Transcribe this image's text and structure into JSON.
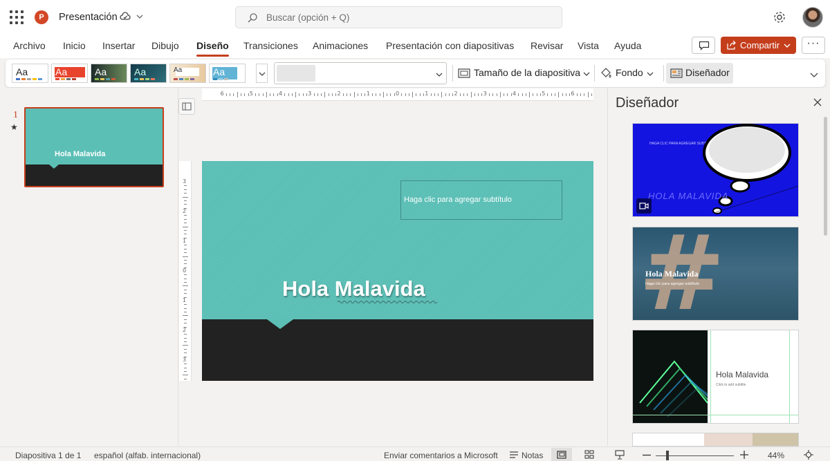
{
  "app": {
    "doc_title": "Presentación",
    "brand_color": "#c43e1c"
  },
  "search": {
    "placeholder": "Buscar (opción + Q)"
  },
  "menu": {
    "tabs": [
      "Archivo",
      "Inicio",
      "Insertar",
      "Dibujo",
      "Diseño",
      "Transiciones",
      "Animaciones",
      "Presentación con diapositivas",
      "Revisar",
      "Vista",
      "Ayuda"
    ],
    "active_tab": "Diseño",
    "share_label": "Compartir",
    "more_label": "···"
  },
  "ribbon": {
    "theme_aa": "Aa",
    "slide_size_label": "Tamaño de la diapositiva",
    "background_label": "Fondo",
    "designer_label": "Diseñador"
  },
  "thumbnails": {
    "slide_number": "1",
    "star": "★",
    "thumb_title": "Hola Malavida"
  },
  "slide": {
    "title": "Hola Malavida",
    "subtitle_placeholder": "Haga clic para agregar subtítulo",
    "accent_color": "#5bbfb6",
    "dark_color": "#222222"
  },
  "rulers": {
    "horizontal_labels": [
      "6",
      "5",
      "4",
      "3",
      "2",
      "1",
      "0",
      "1",
      "2",
      "3",
      "4",
      "5",
      "6"
    ],
    "vertical_labels": [
      "3",
      "2",
      "1",
      "0",
      "1",
      "2",
      "3"
    ]
  },
  "designer": {
    "title": "Diseñador",
    "card1": {
      "small_text": "HAGA CLIC PARA AGREGAR SUBTÍTULO",
      "title": "HOLA MALAVIDA"
    },
    "card2": {
      "title": "Hola Malavida",
      "subtitle": "Haga clic para agregar subtítulo"
    },
    "card3": {
      "title": "Hola Malavida",
      "subtitle": "Click to add subtitle"
    }
  },
  "status": {
    "slide_info": "Diapositiva 1 de 1",
    "language": "español (alfab. internacional)",
    "feedback": "Enviar comentarios a Microsoft",
    "notes": "Notas",
    "zoom": "44%"
  }
}
